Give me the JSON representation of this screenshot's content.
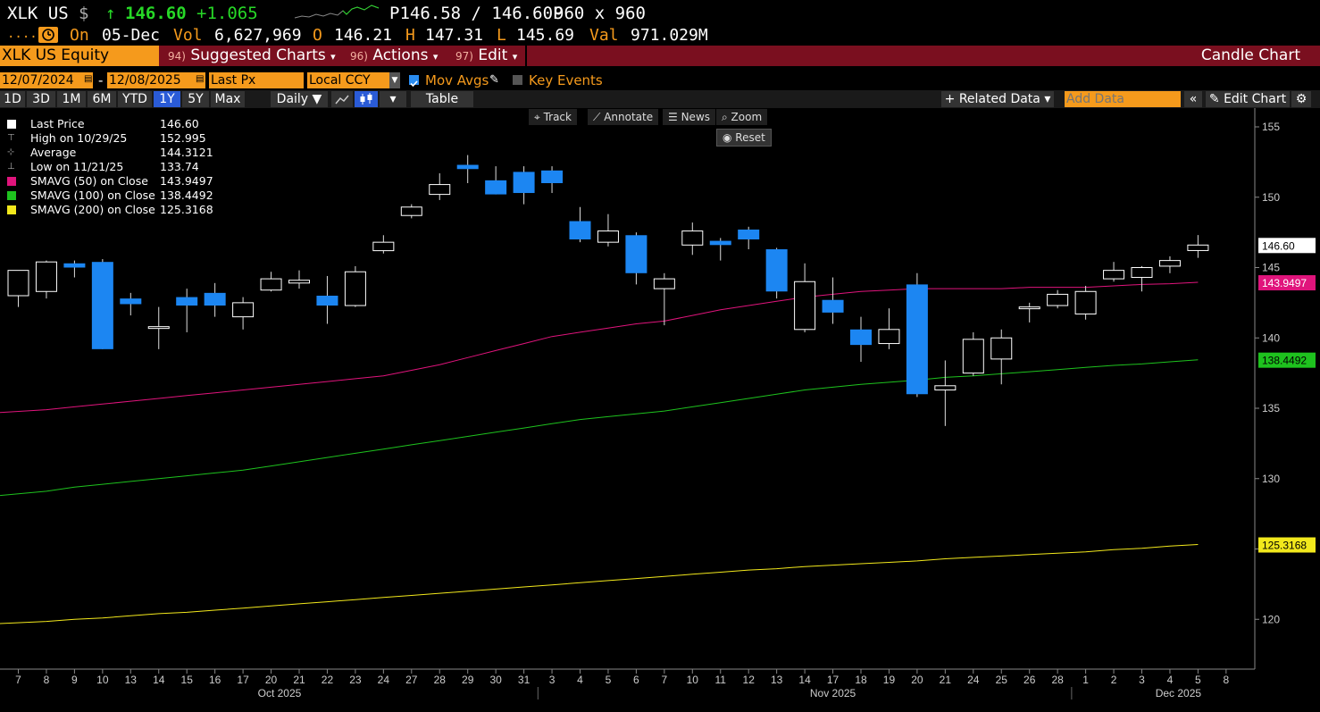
{
  "quote": {
    "ticker": "XLK US",
    "currency_symbol": "$",
    "arrow": "↑",
    "last": "146.60",
    "change": "+1.065",
    "bid_ask": "P146.58 / 146.60P",
    "size": "960 x 960",
    "on_label": "On",
    "date": "05-Dec",
    "vol_label": "Vol",
    "vol": "6,627,969",
    "o_label": "O",
    "open": "146.21",
    "h_label": "H",
    "high": "147.31",
    "l_label": "L",
    "low": "145.69",
    "val_label": "Val",
    "val": "971.029M",
    "dots": ".....",
    "clock_icon": "clock-icon"
  },
  "menubar": {
    "security": "XLK US Equity",
    "suggested_num": "94)",
    "suggested": "Suggested Charts",
    "actions_num": "96)",
    "actions": "Actions",
    "edit_num": "97)",
    "edit": "Edit",
    "chart_type": "Candle Chart"
  },
  "controls": {
    "start_date": "12/07/2024",
    "dash": "-",
    "end_date": "12/08/2025",
    "field": "Last Px",
    "currency": "Local CCY",
    "mov_avgs": "Mov Avgs",
    "key_events": "Key Events",
    "mov_avgs_checked": true,
    "key_events_checked": false
  },
  "rangebar": {
    "ranges": [
      "1D",
      "3D",
      "1M",
      "6M",
      "YTD",
      "1Y",
      "5Y",
      "Max"
    ],
    "active": "1Y",
    "period": "Daily ▼",
    "table": "Table",
    "related": "+ Related Data ▾",
    "add_data_placeholder": "Add Data",
    "edit_chart": "Edit Chart"
  },
  "toolbar": {
    "track": "Track",
    "annotate": "Annotate",
    "news": "News",
    "zoom": "Zoom",
    "reset": "Reset"
  },
  "legend": [
    {
      "label": "Last Price",
      "value": "146.60",
      "color": "#ffffff",
      "kind": "box"
    },
    {
      "label": "High on 10/29/25",
      "value": "152.995",
      "color": "#aaaaaa",
      "kind": "high"
    },
    {
      "label": "Average",
      "value": "144.3121",
      "color": "#aaaaaa",
      "kind": "avg"
    },
    {
      "label": "Low on 11/21/25",
      "value": "133.74",
      "color": "#aaaaaa",
      "kind": "low"
    },
    {
      "label": "SMAVG (50)  on Close",
      "value": "143.9497",
      "color": "#e0147c",
      "kind": "box"
    },
    {
      "label": "SMAVG (100)  on Close",
      "value": "138.4492",
      "color": "#1ec21e",
      "kind": "box"
    },
    {
      "label": "SMAVG (200)  on Close",
      "value": "125.3168",
      "color": "#f2e81c",
      "kind": "box"
    }
  ],
  "chart_data": {
    "type": "candlestick",
    "title": "Candle Chart",
    "ylim": [
      116,
      156
    ],
    "yticks": [
      120,
      125,
      130,
      135,
      140,
      145,
      150,
      155
    ],
    "x_month_labels": [
      "Oct 2025",
      "Nov 2025",
      "Dec 2025"
    ],
    "colors": {
      "up": "#ffffff",
      "down": "#1c86f2",
      "sma50": "#e0147c",
      "sma100": "#1ec21e",
      "sma200": "#f2e81c"
    },
    "candles": [
      {
        "d": "7",
        "o": 143.0,
        "h": 144.5,
        "l": 142.2,
        "c": 144.8
      },
      {
        "d": "8",
        "o": 143.3,
        "h": 145.5,
        "l": 142.8,
        "c": 145.4
      },
      {
        "d": "9",
        "o": 145.3,
        "h": 145.5,
        "l": 144.3,
        "c": 145.0
      },
      {
        "d": "10",
        "o": 145.4,
        "h": 145.6,
        "l": 139.2,
        "c": 139.2
      },
      {
        "d": "13",
        "o": 142.8,
        "h": 143.2,
        "l": 141.6,
        "c": 142.4
      },
      {
        "d": "14",
        "o": 140.8,
        "h": 142.2,
        "l": 139.2,
        "c": 140.8
      },
      {
        "d": "15",
        "o": 142.9,
        "h": 143.5,
        "l": 140.4,
        "c": 142.3
      },
      {
        "d": "16",
        "o": 143.2,
        "h": 143.9,
        "l": 141.5,
        "c": 142.3
      },
      {
        "d": "17",
        "o": 141.5,
        "h": 142.9,
        "l": 140.6,
        "c": 142.5
      },
      {
        "d": "20",
        "o": 143.4,
        "h": 144.7,
        "l": 143.3,
        "c": 144.2
      },
      {
        "d": "21",
        "o": 143.9,
        "h": 144.8,
        "l": 143.5,
        "c": 144.1
      },
      {
        "d": "22",
        "o": 143.0,
        "h": 144.4,
        "l": 141.0,
        "c": 142.3
      },
      {
        "d": "23",
        "o": 142.3,
        "h": 145.1,
        "l": 142.2,
        "c": 144.7
      },
      {
        "d": "24",
        "o": 146.2,
        "h": 147.3,
        "l": 146.0,
        "c": 146.8
      },
      {
        "d": "27",
        "o": 148.7,
        "h": 149.5,
        "l": 148.5,
        "c": 149.3
      },
      {
        "d": "28",
        "o": 150.2,
        "h": 151.7,
        "l": 149.8,
        "c": 150.9
      },
      {
        "d": "29",
        "o": 152.3,
        "h": 152.995,
        "l": 151.0,
        "c": 152.0
      },
      {
        "d": "30",
        "o": 151.2,
        "h": 152.2,
        "l": 150.2,
        "c": 150.2
      },
      {
        "d": "31",
        "o": 151.8,
        "h": 152.2,
        "l": 149.5,
        "c": 150.3
      },
      {
        "d": "3",
        "o": 151.9,
        "h": 152.2,
        "l": 150.3,
        "c": 151.0
      },
      {
        "d": "4",
        "o": 148.3,
        "h": 149.3,
        "l": 146.8,
        "c": 147.0
      },
      {
        "d": "5",
        "o": 146.8,
        "h": 148.8,
        "l": 146.5,
        "c": 147.6
      },
      {
        "d": "6",
        "o": 147.3,
        "h": 147.5,
        "l": 143.8,
        "c": 144.6
      },
      {
        "d": "7",
        "o": 143.5,
        "h": 144.6,
        "l": 140.9,
        "c": 144.2
      },
      {
        "d": "10",
        "o": 146.6,
        "h": 148.2,
        "l": 145.9,
        "c": 147.6
      },
      {
        "d": "11",
        "o": 146.9,
        "h": 147.1,
        "l": 145.5,
        "c": 146.6
      },
      {
        "d": "12",
        "o": 147.7,
        "h": 147.9,
        "l": 146.3,
        "c": 147.0
      },
      {
        "d": "13",
        "o": 146.3,
        "h": 146.4,
        "l": 142.8,
        "c": 143.3
      },
      {
        "d": "14",
        "o": 140.6,
        "h": 145.3,
        "l": 140.4,
        "c": 144.0
      },
      {
        "d": "17",
        "o": 142.7,
        "h": 144.3,
        "l": 141.0,
        "c": 141.8
      },
      {
        "d": "18",
        "o": 140.6,
        "h": 141.5,
        "l": 138.3,
        "c": 139.5
      },
      {
        "d": "19",
        "o": 139.6,
        "h": 142.1,
        "l": 139.2,
        "c": 140.6
      },
      {
        "d": "20",
        "o": 143.8,
        "h": 144.6,
        "l": 135.8,
        "c": 136.0
      },
      {
        "d": "21",
        "o": 136.3,
        "h": 138.4,
        "l": 133.74,
        "c": 136.6
      },
      {
        "d": "24",
        "o": 137.5,
        "h": 140.4,
        "l": 137.3,
        "c": 139.9
      },
      {
        "d": "25",
        "o": 138.5,
        "h": 140.6,
        "l": 136.7,
        "c": 140.0
      },
      {
        "d": "26",
        "o": 142.1,
        "h": 142.5,
        "l": 141.1,
        "c": 142.2
      },
      {
        "d": "28",
        "o": 142.3,
        "h": 143.4,
        "l": 142.1,
        "c": 143.1
      },
      {
        "d": "1",
        "o": 141.7,
        "h": 143.7,
        "l": 141.3,
        "c": 143.3
      },
      {
        "d": "2",
        "o": 144.2,
        "h": 145.4,
        "l": 144.0,
        "c": 144.8
      },
      {
        "d": "3",
        "o": 144.3,
        "h": 145.1,
        "l": 143.3,
        "c": 145.0
      },
      {
        "d": "4",
        "o": 145.1,
        "h": 145.8,
        "l": 144.6,
        "c": 145.5
      },
      {
        "d": "5",
        "o": 146.21,
        "h": 147.31,
        "l": 145.69,
        "c": 146.6
      }
    ],
    "x_tick_labels": [
      "7",
      "8",
      "9",
      "10",
      "13",
      "14",
      "15",
      "16",
      "17",
      "20",
      "21",
      "22",
      "23",
      "24",
      "27",
      "28",
      "29",
      "30",
      "31",
      "3",
      "4",
      "5",
      "6",
      "7",
      "10",
      "11",
      "12",
      "13",
      "14",
      "17",
      "18",
      "19",
      "20",
      "21",
      "24",
      "25",
      "26",
      "28",
      "1",
      "2",
      "3",
      "4",
      "5",
      "8"
    ],
    "sma50": [
      134.7,
      134.9,
      135.1,
      135.3,
      135.5,
      135.7,
      135.9,
      136.1,
      136.3,
      136.5,
      136.7,
      136.9,
      137.1,
      137.3,
      137.7,
      138.1,
      138.6,
      139.1,
      139.6,
      140.1,
      140.4,
      140.7,
      141.0,
      141.2,
      141.6,
      142.0,
      142.3,
      142.6,
      142.9,
      143.1,
      143.3,
      143.4,
      143.5,
      143.5,
      143.5,
      143.5,
      143.6,
      143.6,
      143.6,
      143.7,
      143.8,
      143.85,
      143.9497
    ],
    "sma100": [
      128.8,
      129.1,
      129.4,
      129.6,
      129.8,
      130.0,
      130.2,
      130.4,
      130.6,
      130.9,
      131.2,
      131.5,
      131.8,
      132.1,
      132.4,
      132.7,
      133.0,
      133.3,
      133.6,
      133.9,
      134.2,
      134.4,
      134.6,
      134.8,
      135.1,
      135.4,
      135.7,
      136.0,
      136.3,
      136.5,
      136.7,
      136.85,
      137.0,
      137.2,
      137.3,
      137.45,
      137.6,
      137.75,
      137.9,
      138.05,
      138.15,
      138.3,
      138.4492
    ],
    "sma200": [
      119.7,
      119.85,
      120.0,
      120.1,
      120.25,
      120.4,
      120.5,
      120.65,
      120.8,
      120.95,
      121.1,
      121.25,
      121.4,
      121.55,
      121.7,
      121.85,
      122.0,
      122.15,
      122.3,
      122.45,
      122.6,
      122.75,
      122.9,
      123.05,
      123.2,
      123.35,
      123.5,
      123.6,
      123.75,
      123.85,
      123.95,
      124.05,
      124.15,
      124.3,
      124.4,
      124.5,
      124.6,
      124.7,
      124.8,
      124.95,
      125.05,
      125.2,
      125.3168
    ],
    "right_labels": [
      {
        "value": 146.6,
        "text": "146.60",
        "bg": "#ffffff",
        "fg": "#000000"
      },
      {
        "value": 143.9497,
        "text": "143.9497",
        "bg": "#e0147c",
        "fg": "#ffffff"
      },
      {
        "value": 138.4492,
        "text": "138.4492",
        "bg": "#1ec21e",
        "fg": "#000000"
      },
      {
        "value": 125.3168,
        "text": "125.3168",
        "bg": "#f2e81c",
        "fg": "#000000"
      }
    ]
  }
}
